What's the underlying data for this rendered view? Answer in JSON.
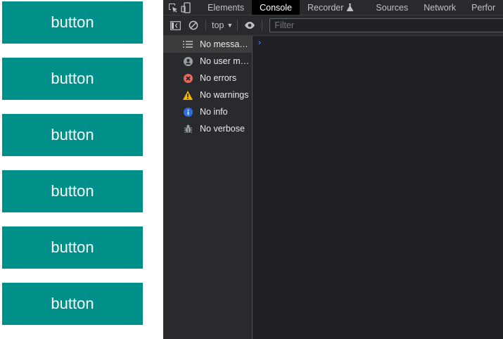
{
  "page": {
    "buttons": [
      "button",
      "button",
      "button",
      "button",
      "button",
      "button"
    ]
  },
  "devtools": {
    "tabs": [
      "Elements",
      "Console",
      "Recorder",
      "Sources",
      "Network",
      "Perfor"
    ],
    "active_tab": "Console",
    "context": "top",
    "filter_placeholder": "Filter",
    "sidebar": [
      {
        "label": "No messages",
        "icon": "list-icon",
        "selected": true
      },
      {
        "label": "No user me...",
        "icon": "user-icon",
        "selected": false
      },
      {
        "label": "No errors",
        "icon": "error-icon",
        "selected": false
      },
      {
        "label": "No warnings",
        "icon": "warning-icon",
        "selected": false
      },
      {
        "label": "No info",
        "icon": "info-icon",
        "selected": false
      },
      {
        "label": "No verbose",
        "icon": "bug-icon",
        "selected": false
      }
    ],
    "prompt": "›"
  },
  "colors": {
    "button_bg": "#009089",
    "devtools_bg": "#202124",
    "error": "#e46962",
    "warning": "#f2b600",
    "info": "#2f6fdb"
  }
}
